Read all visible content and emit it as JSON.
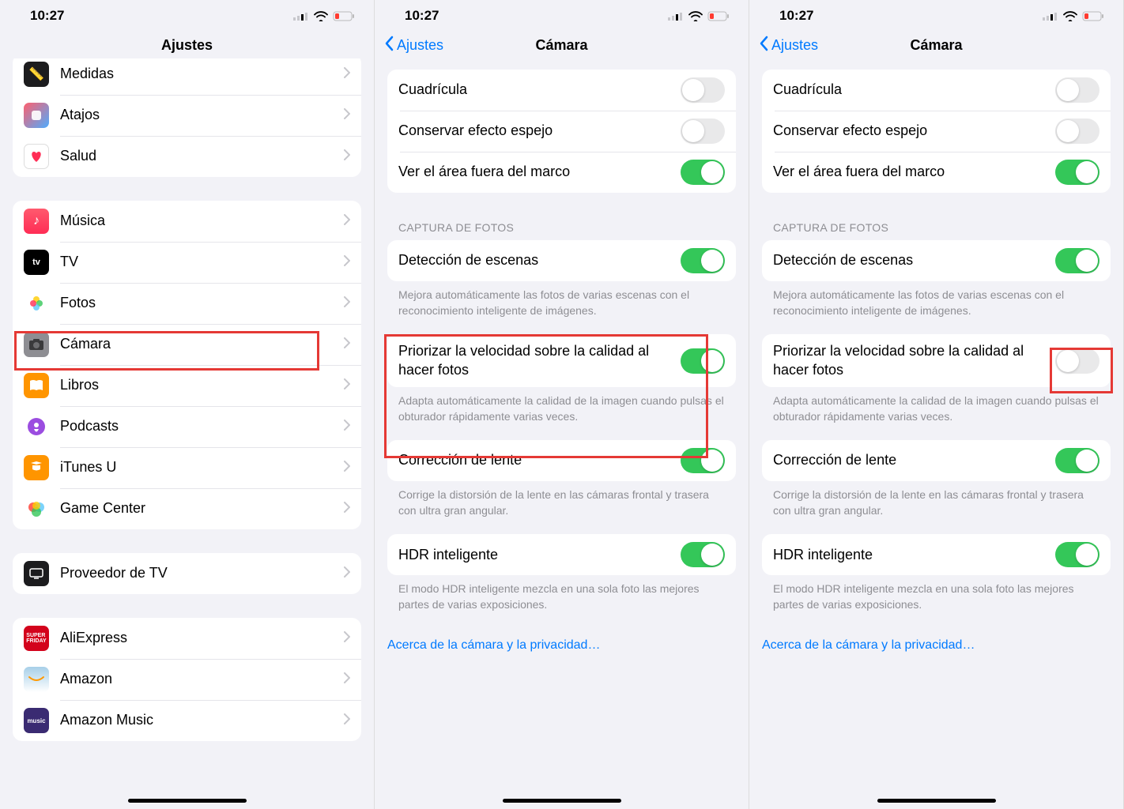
{
  "status": {
    "time": "10:27"
  },
  "phone1": {
    "title": "Ajustes",
    "groups": [
      {
        "items": [
          {
            "label": "Medidas",
            "icon": "ruler"
          },
          {
            "label": "Atajos",
            "icon": "shortcuts"
          },
          {
            "label": "Salud",
            "icon": "health"
          }
        ]
      },
      {
        "items": [
          {
            "label": "Música",
            "icon": "music"
          },
          {
            "label": "TV",
            "icon": "tv"
          },
          {
            "label": "Fotos",
            "icon": "photos"
          },
          {
            "label": "Cámara",
            "icon": "camera"
          },
          {
            "label": "Libros",
            "icon": "books"
          },
          {
            "label": "Podcasts",
            "icon": "podcasts"
          },
          {
            "label": "iTunes U",
            "icon": "itunesu"
          },
          {
            "label": "Game Center",
            "icon": "gamecenter"
          }
        ]
      },
      {
        "items": [
          {
            "label": "Proveedor de TV",
            "icon": "tvprovider"
          }
        ]
      },
      {
        "items": [
          {
            "label": "AliExpress",
            "icon": "aliexpress"
          },
          {
            "label": "Amazon",
            "icon": "amazon"
          },
          {
            "label": "Amazon Music",
            "icon": "amazonmusic"
          }
        ]
      }
    ]
  },
  "camera": {
    "back": "Ajustes",
    "title": "Cámara",
    "composition": [
      {
        "label": "Cuadrícula",
        "on": false
      },
      {
        "label": "Conservar efecto espejo",
        "on": false
      },
      {
        "label": "Ver el área fuera del marco",
        "on": true
      }
    ],
    "capture_header": "CAPTURA DE FOTOS",
    "scene": {
      "label": "Detección de escenas",
      "on": true
    },
    "scene_footer": "Mejora automáticamente las fotos de varias escenas con el reconocimiento inteligente de imágenes.",
    "prioritize": {
      "label": "Priorizar la velocidad sobre la calidad al hacer fotos"
    },
    "prioritize_footer": "Adapta automáticamente la calidad de la imagen cuando pulsas el obturador rápidamente varias veces.",
    "lens": {
      "label": "Corrección de lente",
      "on": true
    },
    "lens_footer": "Corrige la distorsión de la lente en las cámaras frontal y trasera con ultra gran angular.",
    "hdr": {
      "label": "HDR inteligente",
      "on": true
    },
    "hdr_footer": "El modo HDR inteligente mezcla en una sola foto las mejores partes de varias exposiciones.",
    "privacy_link": "Acerca de la cámara y la privacidad…"
  },
  "phone2_prioritize_on": true,
  "phone3_prioritize_on": false
}
